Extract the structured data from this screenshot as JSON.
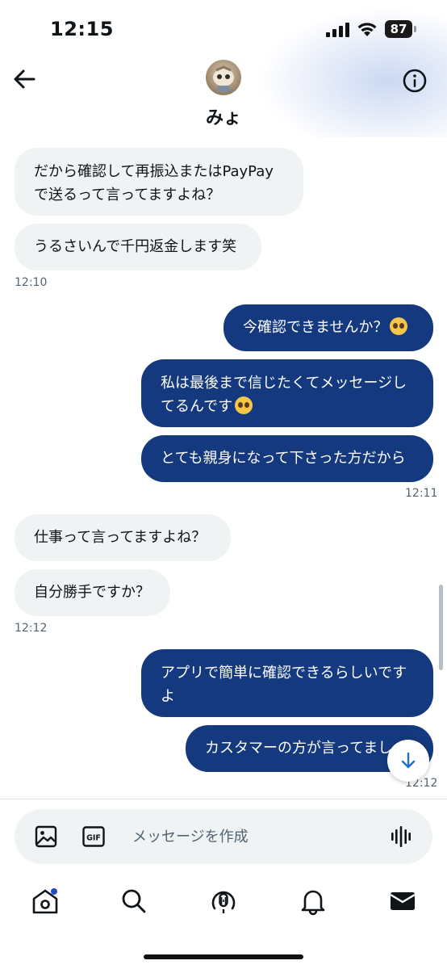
{
  "status_bar": {
    "time": "12:15",
    "battery": "87"
  },
  "header": {
    "contact_name": "みょ"
  },
  "messages": [
    {
      "dir": "in",
      "text": "だから確認して再振込またはPayPay\nで送るって言ってますよね？"
    },
    {
      "dir": "in",
      "text": "うるさいんで千円返金します笑"
    },
    {
      "dir": "out",
      "text": "今確認できませんか？",
      "emoji": "pleading-face"
    },
    {
      "dir": "out",
      "text": "私は最後まで信じたくてメッセージし\nてるんです",
      "emoji": "pleading-face"
    },
    {
      "dir": "out",
      "text": "とても親身になって下さった方だから"
    },
    {
      "dir": "in",
      "text": "仕事って言ってますよね？"
    },
    {
      "dir": "in",
      "text": "自分勝手ですか？"
    },
    {
      "dir": "out",
      "text": "アプリで簡単に確認できるらしいです\nよ"
    },
    {
      "dir": "out",
      "text": "カスタマーの方が言ってまし"
    }
  ],
  "timestamps": [
    "12:10",
    "12:11",
    "12:12",
    "12:12"
  ],
  "composer": {
    "placeholder": "メッセージを作成",
    "gif_label": "GIF"
  },
  "tabs": [
    "home-icon",
    "search-icon",
    "spaces-icon",
    "notifications-icon",
    "messages-icon"
  ],
  "colors": {
    "outgoing_bubble": "#15397f",
    "incoming_bubble": "#eff3f4",
    "accent": "#1d9bf0"
  }
}
